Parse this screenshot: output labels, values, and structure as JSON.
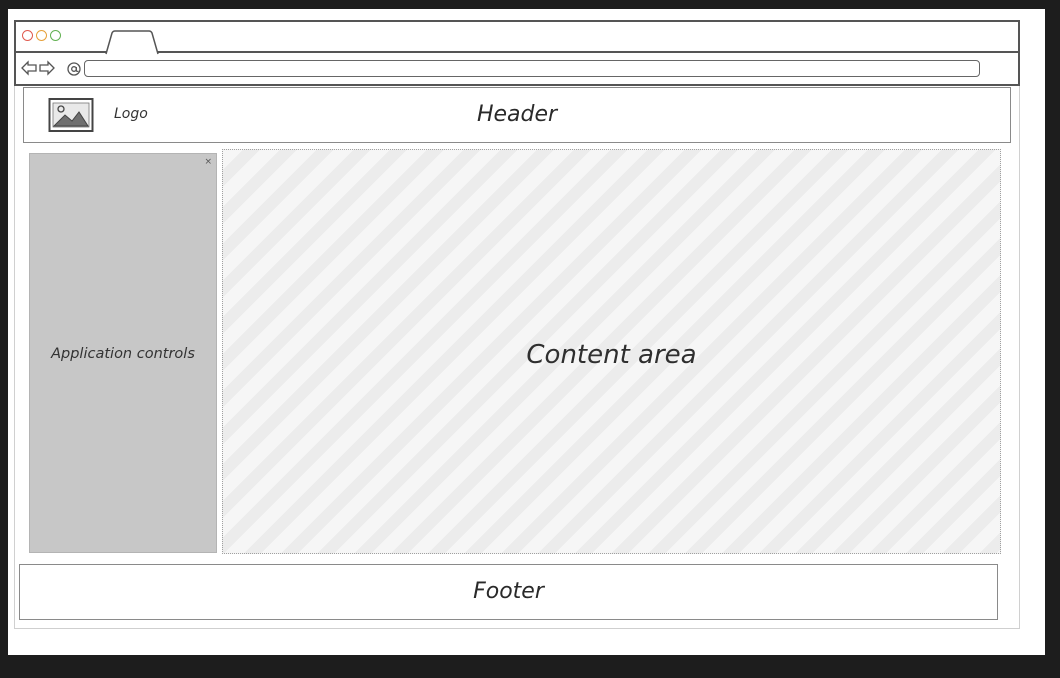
{
  "browser": {
    "window_buttons": [
      "close",
      "minimize",
      "maximize"
    ],
    "icons": [
      "back-arrow-icon",
      "forward-arrow-icon",
      "at-sign-icon"
    ],
    "url_value": ""
  },
  "header": {
    "logo_label": "Logo",
    "title": "Header"
  },
  "sidebar": {
    "label": "Application controls",
    "close_glyph": "×"
  },
  "content": {
    "label": "Content area"
  },
  "footer": {
    "label": "Footer"
  },
  "colors": {
    "close_dot": "#e05a4f",
    "minimize_dot": "#e6a03a",
    "maximize_dot": "#62b152",
    "sidebar_bg": "#c7c7c7",
    "content_bg": "#f5f5f5"
  }
}
